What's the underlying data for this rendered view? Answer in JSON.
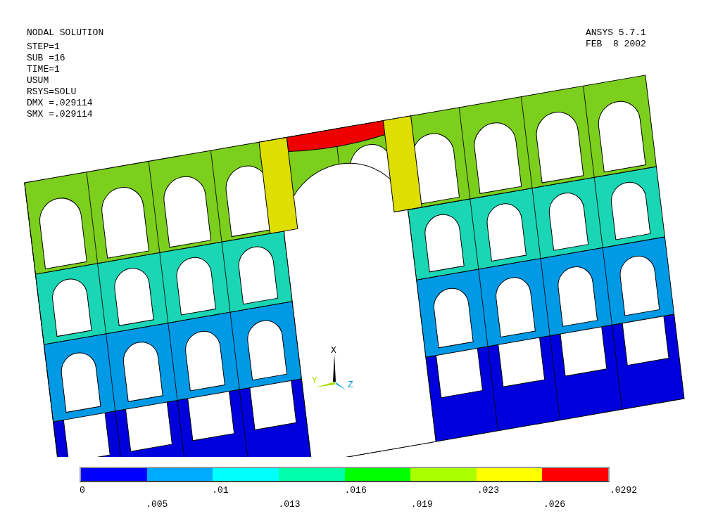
{
  "header": {
    "title": "NODAL SOLUTION",
    "info": [
      "STEP=1",
      "SUB =16",
      "TIME=1",
      "USUM",
      "RSYS=SOLU",
      "DMX =.029114",
      "SMX =.029114"
    ],
    "program": "ANSYS 5.7.1",
    "date": "FEB  8 2002"
  },
  "triad": {
    "labels": [
      "X",
      "Y",
      "Z"
    ]
  },
  "legend": {
    "bands": [
      {
        "color": "#0000ff"
      },
      {
        "color": "#00aaff"
      },
      {
        "color": "#00ffff"
      },
      {
        "color": "#00ffaa"
      },
      {
        "color": "#00ff00"
      },
      {
        "color": "#aaff00"
      },
      {
        "color": "#ffff00"
      },
      {
        "color": "#ff0000"
      }
    ],
    "labels": [
      "0",
      ".005",
      ".01",
      ".013",
      ".016",
      ".019",
      ".023",
      ".026",
      ".0292"
    ]
  }
}
